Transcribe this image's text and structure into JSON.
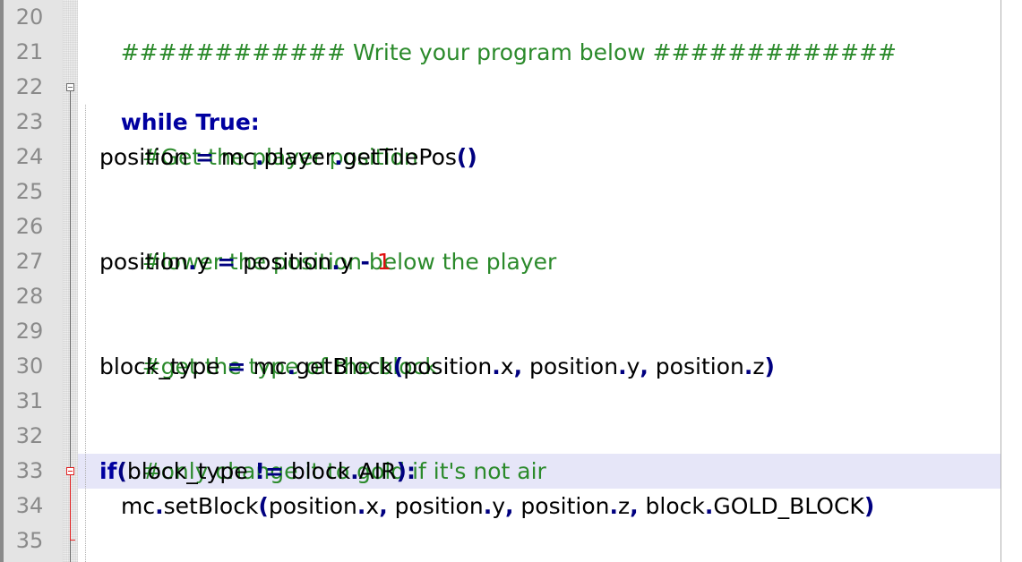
{
  "editor": {
    "line_numbers": [
      "20",
      "21",
      "22",
      "23",
      "24",
      "25",
      "26",
      "27",
      "28",
      "29",
      "30",
      "31",
      "32",
      "33",
      "34",
      "35"
    ],
    "lines": {
      "l20": {
        "comment": "############ Write your program below #############"
      },
      "l22": {
        "kw": "while True:"
      },
      "l23": {
        "comment": "#Get the player position"
      },
      "l24": {
        "a": "position ",
        "eq": "=",
        "b": " mc",
        "d1": ".",
        "c": "player",
        "d2": ".",
        "d": "getTilePos",
        "p": "()"
      },
      "l26": {
        "comment": "#lower the position below the player"
      },
      "l27": {
        "a": "position",
        "d1": ".",
        "b": "y ",
        "eq": "=",
        "c": " position",
        "d2": ".",
        "d": "y ",
        "minus": "-",
        "sp": " ",
        "num": "1"
      },
      "l29": {
        "comment": "#get the type of the block"
      },
      "l30": {
        "a": "block_type ",
        "eq": "=",
        "b": " mc",
        "d1": ".",
        "c": "getBlock",
        "p1": "(",
        "d": "position",
        "d2": ".",
        "e": "x",
        "c1": ",",
        "f": " position",
        "d3": ".",
        "g": "y",
        "c2": ",",
        "h": " position",
        "d4": ".",
        "i": "z",
        "p2": ")"
      },
      "l32": {
        "comment": "#only change it to gold if it's not air"
      },
      "l33": {
        "kw": "if",
        "p1": "(",
        "a": "block_type ",
        "ne": "!=",
        "b": " block",
        "d1": ".",
        "c": "AIR",
        "p2": "):"
      },
      "l34": {
        "a": "mc",
        "d1": ".",
        "b": "setBlock",
        "p1": "(",
        "c": "position",
        "d2": ".",
        "d": "x",
        "c1": ",",
        "e": " position",
        "d3": ".",
        "f": "y",
        "c2": ",",
        "g": " position",
        "d4": ".",
        "h": "z",
        "c3": ",",
        "i": " block",
        "d5": ".",
        "j": "GOLD_BLOCK",
        "p2": ")"
      }
    },
    "colors": {
      "comment": "#2b8a2b",
      "keyword": "#0000a0",
      "number": "#e01010",
      "current_line": "#e6e6f8",
      "gutter": "#e4e4e4"
    }
  }
}
